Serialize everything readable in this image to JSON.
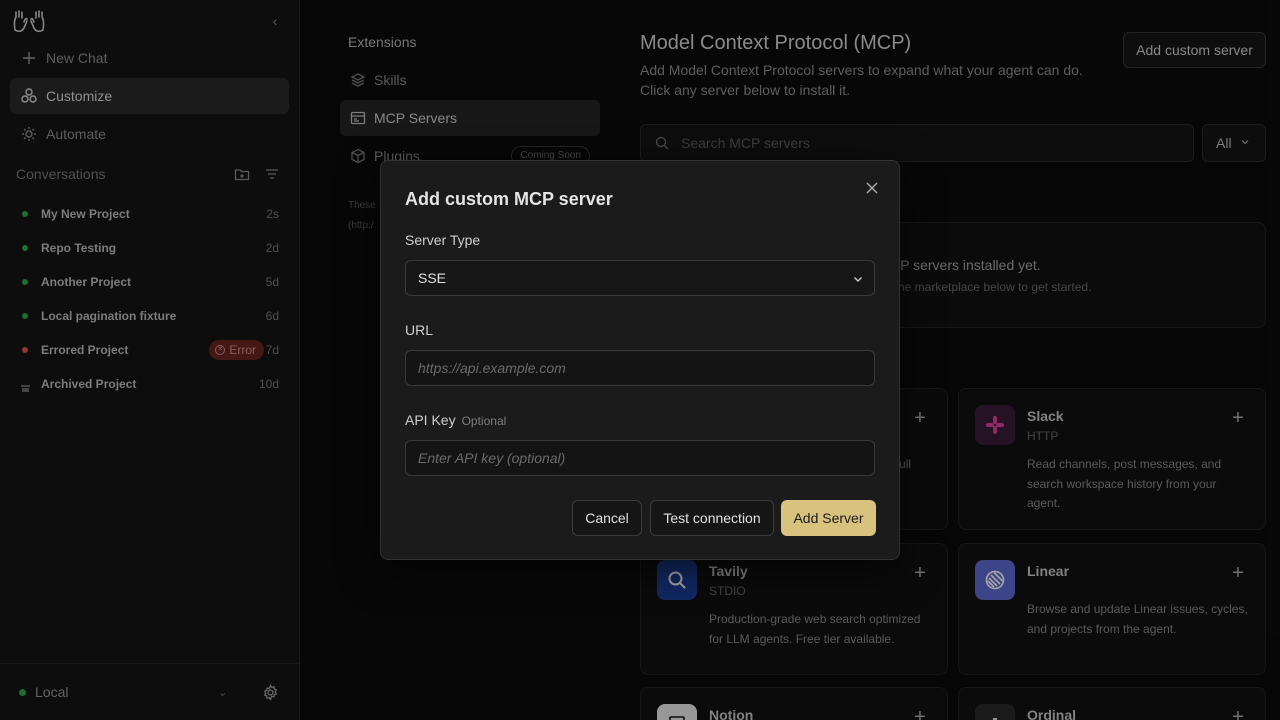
{
  "sidebar": {
    "nav": [
      {
        "label": "New Chat",
        "icon": "plus-icon"
      },
      {
        "label": "Customize",
        "icon": "customize-icon"
      },
      {
        "label": "Automate",
        "icon": "automate-icon"
      }
    ],
    "conversations_title": "Conversations",
    "conversations": [
      {
        "title": "My New Project",
        "time": "2s",
        "status_color": "#2fa84f"
      },
      {
        "title": "Repo Testing",
        "time": "2d",
        "status_color": "#2fa84f"
      },
      {
        "title": "Another Project",
        "time": "5d",
        "status_color": "#2fa84f"
      },
      {
        "title": "Local pagination fixture",
        "time": "6d",
        "status_color": "#2fa84f"
      },
      {
        "title": "Errored Project",
        "time": "7d",
        "status_color": "#d9534f",
        "badge": "Error"
      },
      {
        "title": "Archived Project",
        "time": "10d",
        "status_color": "#6a6a6a"
      }
    ],
    "footer": {
      "environment": "Local",
      "environment_color": "#2fa84f"
    }
  },
  "subnav": {
    "title": "Extensions",
    "items": [
      {
        "label": "Skills"
      },
      {
        "label": "MCP Servers"
      },
      {
        "label": "Plugins",
        "badge": "Coming Soon"
      }
    ],
    "note": "These (http:/"
  },
  "main": {
    "title": "Model Context Protocol (MCP)",
    "description": "Add Model Context Protocol servers to expand what your agent can do. Click any server below to install it.",
    "add_custom_label": "Add custom server",
    "search_placeholder": "Search MCP servers",
    "filter_value": "All",
    "empty_title": "CP servers installed yet.",
    "empty_sub": "he marketplace below to get started.",
    "cards": [
      {
        "name": "Slack",
        "transport": "HTTP",
        "description": "Read channels, post messages, and search workspace history from your agent.",
        "color": "#3b1d3a"
      },
      {
        "name": "Tavily",
        "transport": "STDIO",
        "description": "Production-grade web search optimized for LLM agents. Free tier available.",
        "color": "#1d3f9a"
      },
      {
        "name": "Linear",
        "transport": "",
        "description": "Browse and update Linear issues, cycles, and projects from the agent.",
        "color": "#5e6ad2"
      },
      {
        "name": "Notion",
        "transport": "",
        "description": "",
        "color": "#e8e8e8"
      },
      {
        "name": "Ordinal",
        "transport": "",
        "description": "",
        "color": "#2a2a2a"
      }
    ],
    "partial_card_text": "ull"
  },
  "modal": {
    "title": "Add custom MCP server",
    "server_type_label": "Server Type",
    "server_type_value": "SSE",
    "url_label": "URL",
    "url_placeholder": "https://api.example.com",
    "api_key_label": "API Key",
    "api_key_optional": "Optional",
    "api_key_placeholder": "Enter API key (optional)",
    "cancel_label": "Cancel",
    "test_label": "Test connection",
    "add_label": "Add Server",
    "accent": "#d9c27d"
  }
}
